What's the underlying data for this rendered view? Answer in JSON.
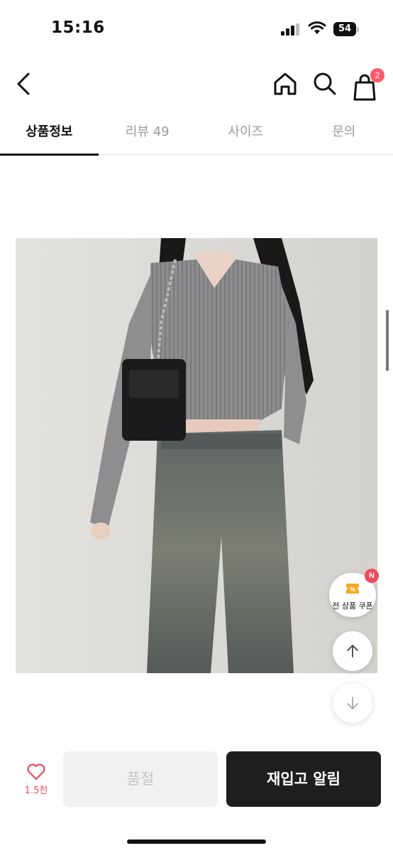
{
  "status_bar": {
    "time": "15:16",
    "battery": "54"
  },
  "header": {
    "cart_count": "2"
  },
  "tabs": [
    {
      "label": "상품정보",
      "active": true
    },
    {
      "label": "리뷰 49",
      "active": false
    },
    {
      "label": "사이즈",
      "active": false
    },
    {
      "label": "문의",
      "active": false
    }
  ],
  "floating": {
    "coupon_label": "전 상품 쿠폰",
    "coupon_badge": "N"
  },
  "bottom_bar": {
    "like_count": "1.5천",
    "soldout_label": "품절",
    "restock_label": "재입고 알림"
  },
  "colors": {
    "accent": "#f04a5c",
    "dark_button": "#1e1e1e",
    "cart_badge": "#ff5a66"
  },
  "icons": [
    "back-icon",
    "home-icon",
    "search-icon",
    "cart-icon",
    "coupon-icon",
    "arrow-up-icon",
    "arrow-down-icon",
    "heart-icon"
  ]
}
